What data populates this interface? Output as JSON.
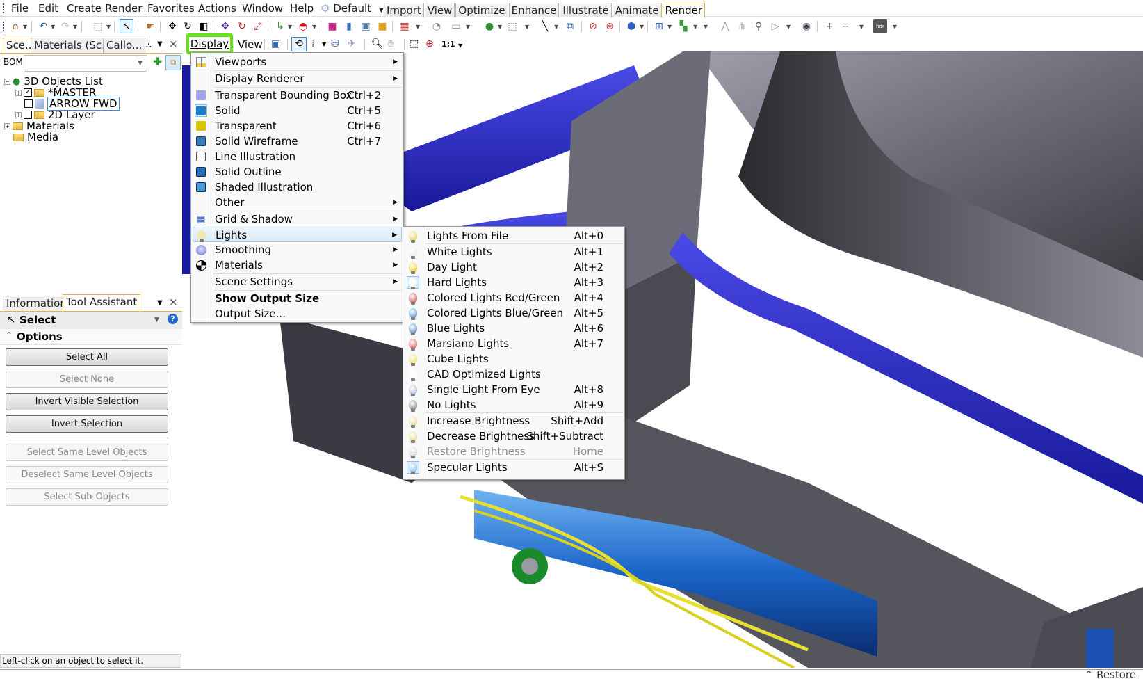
{
  "menubar": {
    "items": [
      "File",
      "Edit",
      "Create",
      "Render",
      "Favorites",
      "Actions",
      "Window",
      "Help"
    ],
    "workspace": "Default",
    "ribbon_tabs": [
      "Import",
      "View",
      "Optimize",
      "Enhance",
      "Illustrate",
      "Animate",
      "Render"
    ],
    "active_ribbon_tab": "Render"
  },
  "toolbar": {
    "zoom_1to1": "1:1",
    "icons": [
      "home-icon",
      "undo-icon",
      "redo-icon",
      "selection-box-icon",
      "select-arrow-icon",
      "hand-pointer-icon",
      "move-icon",
      "rotate-icon",
      "scale-icon",
      "move-object-icon",
      "rotate-object-icon",
      "scale-object-icon",
      "axis-icon",
      "helmet-icon",
      "cube-pink-icon",
      "cube-blue-icon",
      "cube-frame-icon",
      "cube-yellow-icon",
      "grid-icon",
      "smoothing-icon",
      "materials-icon",
      "sphere-icon",
      "bounding-icon",
      "line-icon",
      "connect-icon",
      "explode-icon",
      "collapse-icon",
      "shading-icon",
      "arrange-icon",
      "colors-icon",
      "path-icon",
      "split-icon",
      "camera-icon",
      "play-icon",
      "sky-icon",
      "plus-icon",
      "minus-icon",
      "hdr-icon"
    ]
  },
  "scene_panel": {
    "tabs": [
      "Sce...",
      "Materials (Sc...",
      "Callo..."
    ],
    "active_tab": "Sce...",
    "bom_label": "BOM:",
    "bom_value": "",
    "tree": [
      {
        "label": "3D Objects List",
        "checked": null,
        "level": 0
      },
      {
        "label": "*MASTER",
        "checked": true,
        "level": 1
      },
      {
        "label": "ARROW FWD",
        "checked": false,
        "level": 1,
        "selected": true
      },
      {
        "label": "2D Layer",
        "checked": false,
        "level": 1
      },
      {
        "label": "Materials",
        "checked": null,
        "level": 0
      },
      {
        "label": "Media",
        "checked": null,
        "level": 0
      }
    ]
  },
  "tool_panel": {
    "tabs": [
      "Information",
      "Tool Assistant"
    ],
    "active_tab": "Tool Assistant",
    "tool_name": "Select",
    "section": "Options",
    "buttons": [
      {
        "label": "Select All",
        "enabled": true
      },
      {
        "label": "Select None",
        "enabled": false
      },
      {
        "label": "Invert Visible Selection",
        "enabled": true
      },
      {
        "label": "Invert Selection",
        "enabled": true
      },
      {
        "label": "Select Same Level Objects",
        "enabled": false
      },
      {
        "label": "Deselect Same Level Objects",
        "enabled": false
      },
      {
        "label": "Select Sub-Objects",
        "enabled": false
      }
    ],
    "status": "Left-click on an object to select it."
  },
  "display_bar": {
    "display_label": "Display",
    "view_label": "View",
    "highlight_color": "#66e31a"
  },
  "display_menu": {
    "items": [
      {
        "label": "Viewports",
        "shortcut": "",
        "submenu": true,
        "icon": "viewports-icon"
      },
      {
        "label": "Display Renderer",
        "shortcut": "",
        "submenu": true,
        "icon": ""
      },
      {
        "label": "Transparent Bounding Box",
        "shortcut": "Ctrl+2",
        "submenu": false,
        "icon": "transparent-box-icon"
      },
      {
        "label": "Solid",
        "shortcut": "Ctrl+5",
        "submenu": false,
        "icon": "solid-cube-icon",
        "checked": true
      },
      {
        "label": "Transparent",
        "shortcut": "Ctrl+6",
        "submenu": false,
        "icon": "transparent-cube-icon"
      },
      {
        "label": "Solid Wireframe",
        "shortcut": "Ctrl+7",
        "submenu": false,
        "icon": "wireframe-cube-icon"
      },
      {
        "label": "Line Illustration",
        "shortcut": "",
        "submenu": false,
        "icon": "line-cube-icon"
      },
      {
        "label": "Solid Outline",
        "shortcut": "",
        "submenu": false,
        "icon": "outline-cube-icon"
      },
      {
        "label": "Shaded Illustration",
        "shortcut": "",
        "submenu": false,
        "icon": "shaded-cube-icon"
      },
      {
        "label": "Other",
        "shortcut": "",
        "submenu": true,
        "icon": ""
      },
      {
        "label": "Grid & Shadow",
        "shortcut": "",
        "submenu": true,
        "icon": "grid-icon"
      },
      {
        "label": "Lights",
        "shortcut": "",
        "submenu": true,
        "icon": "bulb-icon",
        "highlighted": true
      },
      {
        "label": "Smoothing",
        "shortcut": "",
        "submenu": true,
        "icon": "smoothing-icon"
      },
      {
        "label": "Materials",
        "shortcut": "",
        "submenu": true,
        "icon": "materials-icon"
      },
      {
        "label": "Scene Settings",
        "shortcut": "",
        "submenu": true,
        "icon": ""
      },
      {
        "label": "Show Output Size",
        "shortcut": "",
        "submenu": false,
        "icon": "",
        "bold": true
      },
      {
        "label": "Output Size...",
        "shortcut": "",
        "submenu": false,
        "icon": ""
      }
    ]
  },
  "lights_menu": {
    "items": [
      {
        "label": "Lights From File",
        "shortcut": "Alt+0",
        "color": "#e8c53a"
      },
      {
        "label": "White Lights",
        "shortcut": "Alt+1",
        "color": "#e6e6e6"
      },
      {
        "label": "Day Light",
        "shortcut": "Alt+2",
        "color": "#f5c400"
      },
      {
        "label": "Hard Lights",
        "shortcut": "Alt+3",
        "color": "#f0f0f0",
        "checked": true
      },
      {
        "label": "Colored Lights Red/Green",
        "shortcut": "Alt+4",
        "color": "#c83a3a"
      },
      {
        "label": "Colored Lights Blue/Green",
        "shortcut": "Alt+5",
        "color": "#3a86c8"
      },
      {
        "label": "Blue Lights",
        "shortcut": "Alt+6",
        "color": "#3b7fc4"
      },
      {
        "label": "Marsiano Lights",
        "shortcut": "Alt+7",
        "color": "#d24545"
      },
      {
        "label": "Cube Lights",
        "shortcut": "",
        "color": "#e9d84a"
      },
      {
        "label": "CAD Optimized Lights",
        "shortcut": "",
        "color": "#fafafa"
      },
      {
        "label": "Single Light From Eye",
        "shortcut": "Alt+8",
        "color": "#9ab0d0"
      },
      {
        "label": "No Lights",
        "shortcut": "Alt+9",
        "color": "#6e6e6e"
      },
      {
        "label": "Increase Brightness",
        "shortcut": "Shift+Add",
        "color": "#e6d27a"
      },
      {
        "label": "Decrease Brightness",
        "shortcut": "Shift+Subtract",
        "color": "#e6d27a"
      },
      {
        "label": "Restore Brightness",
        "shortcut": "Home",
        "color": "#cfcfcf",
        "disabled": true
      },
      {
        "label": "Specular Lights",
        "shortcut": "Alt+S",
        "color": "#6ab4d8",
        "highlighted": true
      }
    ]
  },
  "bottom_bar": {
    "restore_label": "Restore"
  }
}
